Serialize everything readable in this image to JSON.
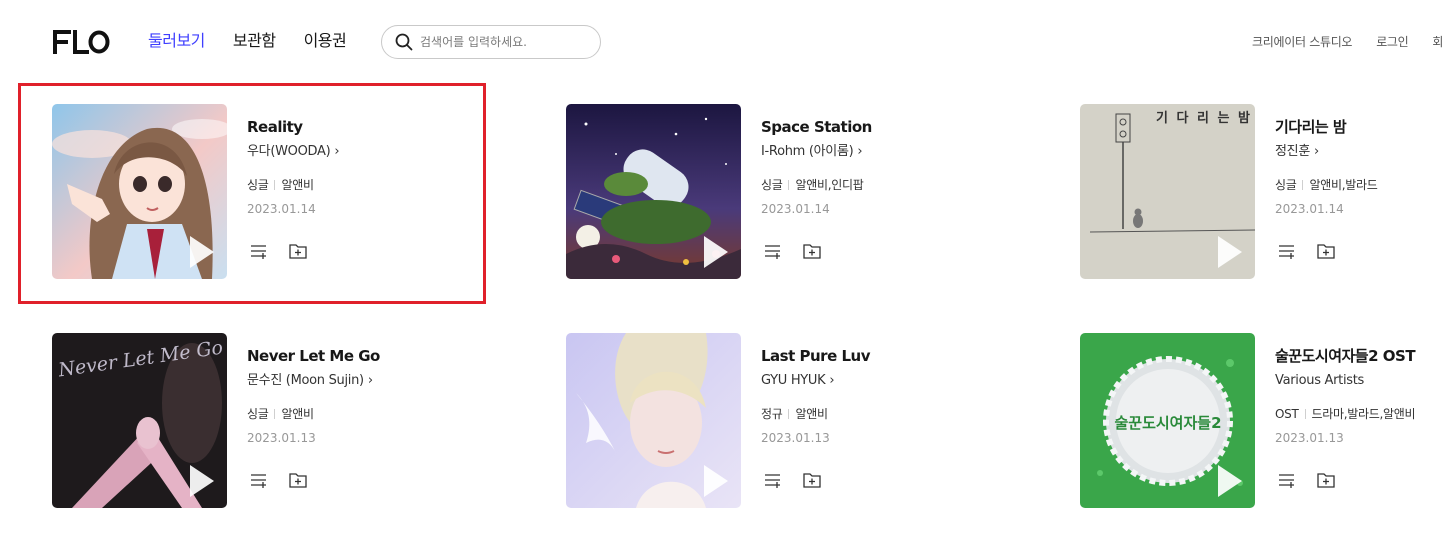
{
  "app": {
    "logo": "FLO"
  },
  "nav": {
    "items": [
      {
        "label": "둘러보기",
        "active": true
      },
      {
        "label": "보관함",
        "active": false
      },
      {
        "label": "이용권",
        "active": false
      }
    ]
  },
  "search": {
    "placeholder": "검색어를 입력하세요.",
    "value": ""
  },
  "utility": {
    "items": [
      "크리에이터 스튜디오",
      "로그인",
      "회"
    ]
  },
  "albums": [
    {
      "title": "Reality",
      "artist": "우다(WOODA)",
      "has_artist_link": true,
      "type": "싱글",
      "genre": "알앤비",
      "date": "2023.01.14",
      "selected": true
    },
    {
      "title": "Space Station",
      "artist": "I-Rohm (아이롬)",
      "has_artist_link": true,
      "type": "싱글",
      "genre": "알앤비,인디팝",
      "date": "2023.01.14"
    },
    {
      "title": "기다리는 밤",
      "artist": "정진훈",
      "has_artist_link": true,
      "type": "싱글",
      "genre": "알앤비,발라드",
      "date": "2023.01.14",
      "cover_text": "기 다 리 는  밤"
    },
    {
      "title": "Never Let Me Go",
      "artist": "문수진 (Moon Sujin)",
      "has_artist_link": true,
      "type": "싱글",
      "genre": "알앤비",
      "date": "2023.01.13",
      "cover_text": "Never Let Me Go"
    },
    {
      "title": "Last Pure Luv",
      "artist": "GYU HYUK",
      "has_artist_link": true,
      "type": "정규",
      "genre": "알앤비",
      "date": "2023.01.13"
    },
    {
      "title": "술꾼도시여자들2 OST",
      "artist": "Various Artists",
      "has_artist_link": false,
      "type": "OST",
      "genre": "드라마,발라드,알앤비",
      "date": "2023.01.13",
      "cover_text": "술꾼도시여자들2"
    }
  ],
  "colors": {
    "accent": "#3f3fff",
    "highlight": "#e0202a",
    "text": "#181818",
    "muted": "#989898"
  },
  "icons": {
    "search": "search-icon",
    "add_to_playlist": "add-to-playlist-icon",
    "add_to_folder": "add-to-folder-icon",
    "play": "play-icon",
    "chevron": "chevron-right-icon"
  }
}
